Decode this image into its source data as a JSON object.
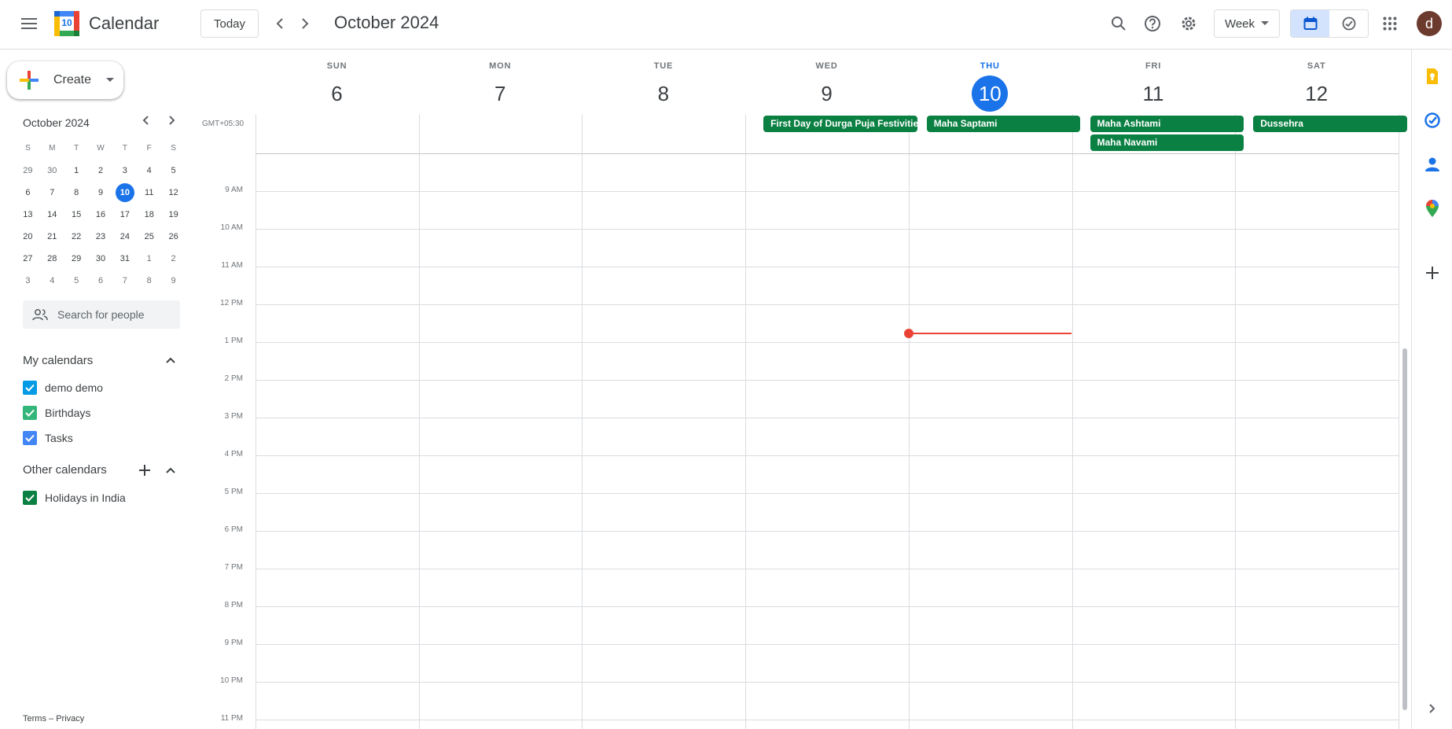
{
  "app": {
    "name": "Calendar",
    "logo_day": "10"
  },
  "header": {
    "today_label": "Today",
    "current_period": "October 2024",
    "view_label": "Week",
    "avatar_letter": "d"
  },
  "sidebar": {
    "create_label": "Create",
    "mini_month": "October 2024",
    "weekday_heads": [
      "S",
      "M",
      "T",
      "W",
      "T",
      "F",
      "S"
    ],
    "weeks": [
      [
        "29",
        "30",
        "1",
        "2",
        "3",
        "4",
        "5"
      ],
      [
        "6",
        "7",
        "8",
        "9",
        "10",
        "11",
        "12"
      ],
      [
        "13",
        "14",
        "15",
        "16",
        "17",
        "18",
        "19"
      ],
      [
        "20",
        "21",
        "22",
        "23",
        "24",
        "25",
        "26"
      ],
      [
        "27",
        "28",
        "29",
        "30",
        "31",
        "1",
        "2"
      ],
      [
        "3",
        "4",
        "5",
        "6",
        "7",
        "8",
        "9"
      ]
    ],
    "search_placeholder": "Search for people",
    "my_calendars_title": "My calendars",
    "my_calendars": [
      {
        "label": "demo demo",
        "color": "#039be5"
      },
      {
        "label": "Birthdays",
        "color": "#33b679"
      },
      {
        "label": "Tasks",
        "color": "#4285f4"
      }
    ],
    "other_calendars_title": "Other calendars",
    "other_calendars": [
      {
        "label": "Holidays in India",
        "color": "#0b8043"
      }
    ],
    "footer_terms": "Terms",
    "footer_sep": "–",
    "footer_privacy": "Privacy"
  },
  "week": {
    "timezone": "GMT+05:30",
    "days": [
      {
        "name": "SUN",
        "num": "6"
      },
      {
        "name": "MON",
        "num": "7"
      },
      {
        "name": "TUE",
        "num": "8"
      },
      {
        "name": "WED",
        "num": "9"
      },
      {
        "name": "THU",
        "num": "10",
        "today": true
      },
      {
        "name": "FRI",
        "num": "11"
      },
      {
        "name": "SAT",
        "num": "12"
      }
    ],
    "events": [
      {
        "title": "First Day of Durga Puja Festivities",
        "day": "WED"
      },
      {
        "title": "Maha Saptami",
        "day": "THU"
      },
      {
        "title": "Maha Ashtami",
        "day": "FRI"
      },
      {
        "title": "Maha Navami",
        "day": "FRI"
      },
      {
        "title": "Dussehra",
        "day": "SAT"
      }
    ],
    "event_color": "#0b8043",
    "hours": [
      "9 AM",
      "10 AM",
      "11 AM",
      "12 PM",
      "1 PM",
      "2 PM",
      "3 PM",
      "4 PM",
      "5 PM",
      "6 PM",
      "7 PM",
      "8 PM",
      "9 PM",
      "10 PM",
      "11 PM"
    ]
  }
}
